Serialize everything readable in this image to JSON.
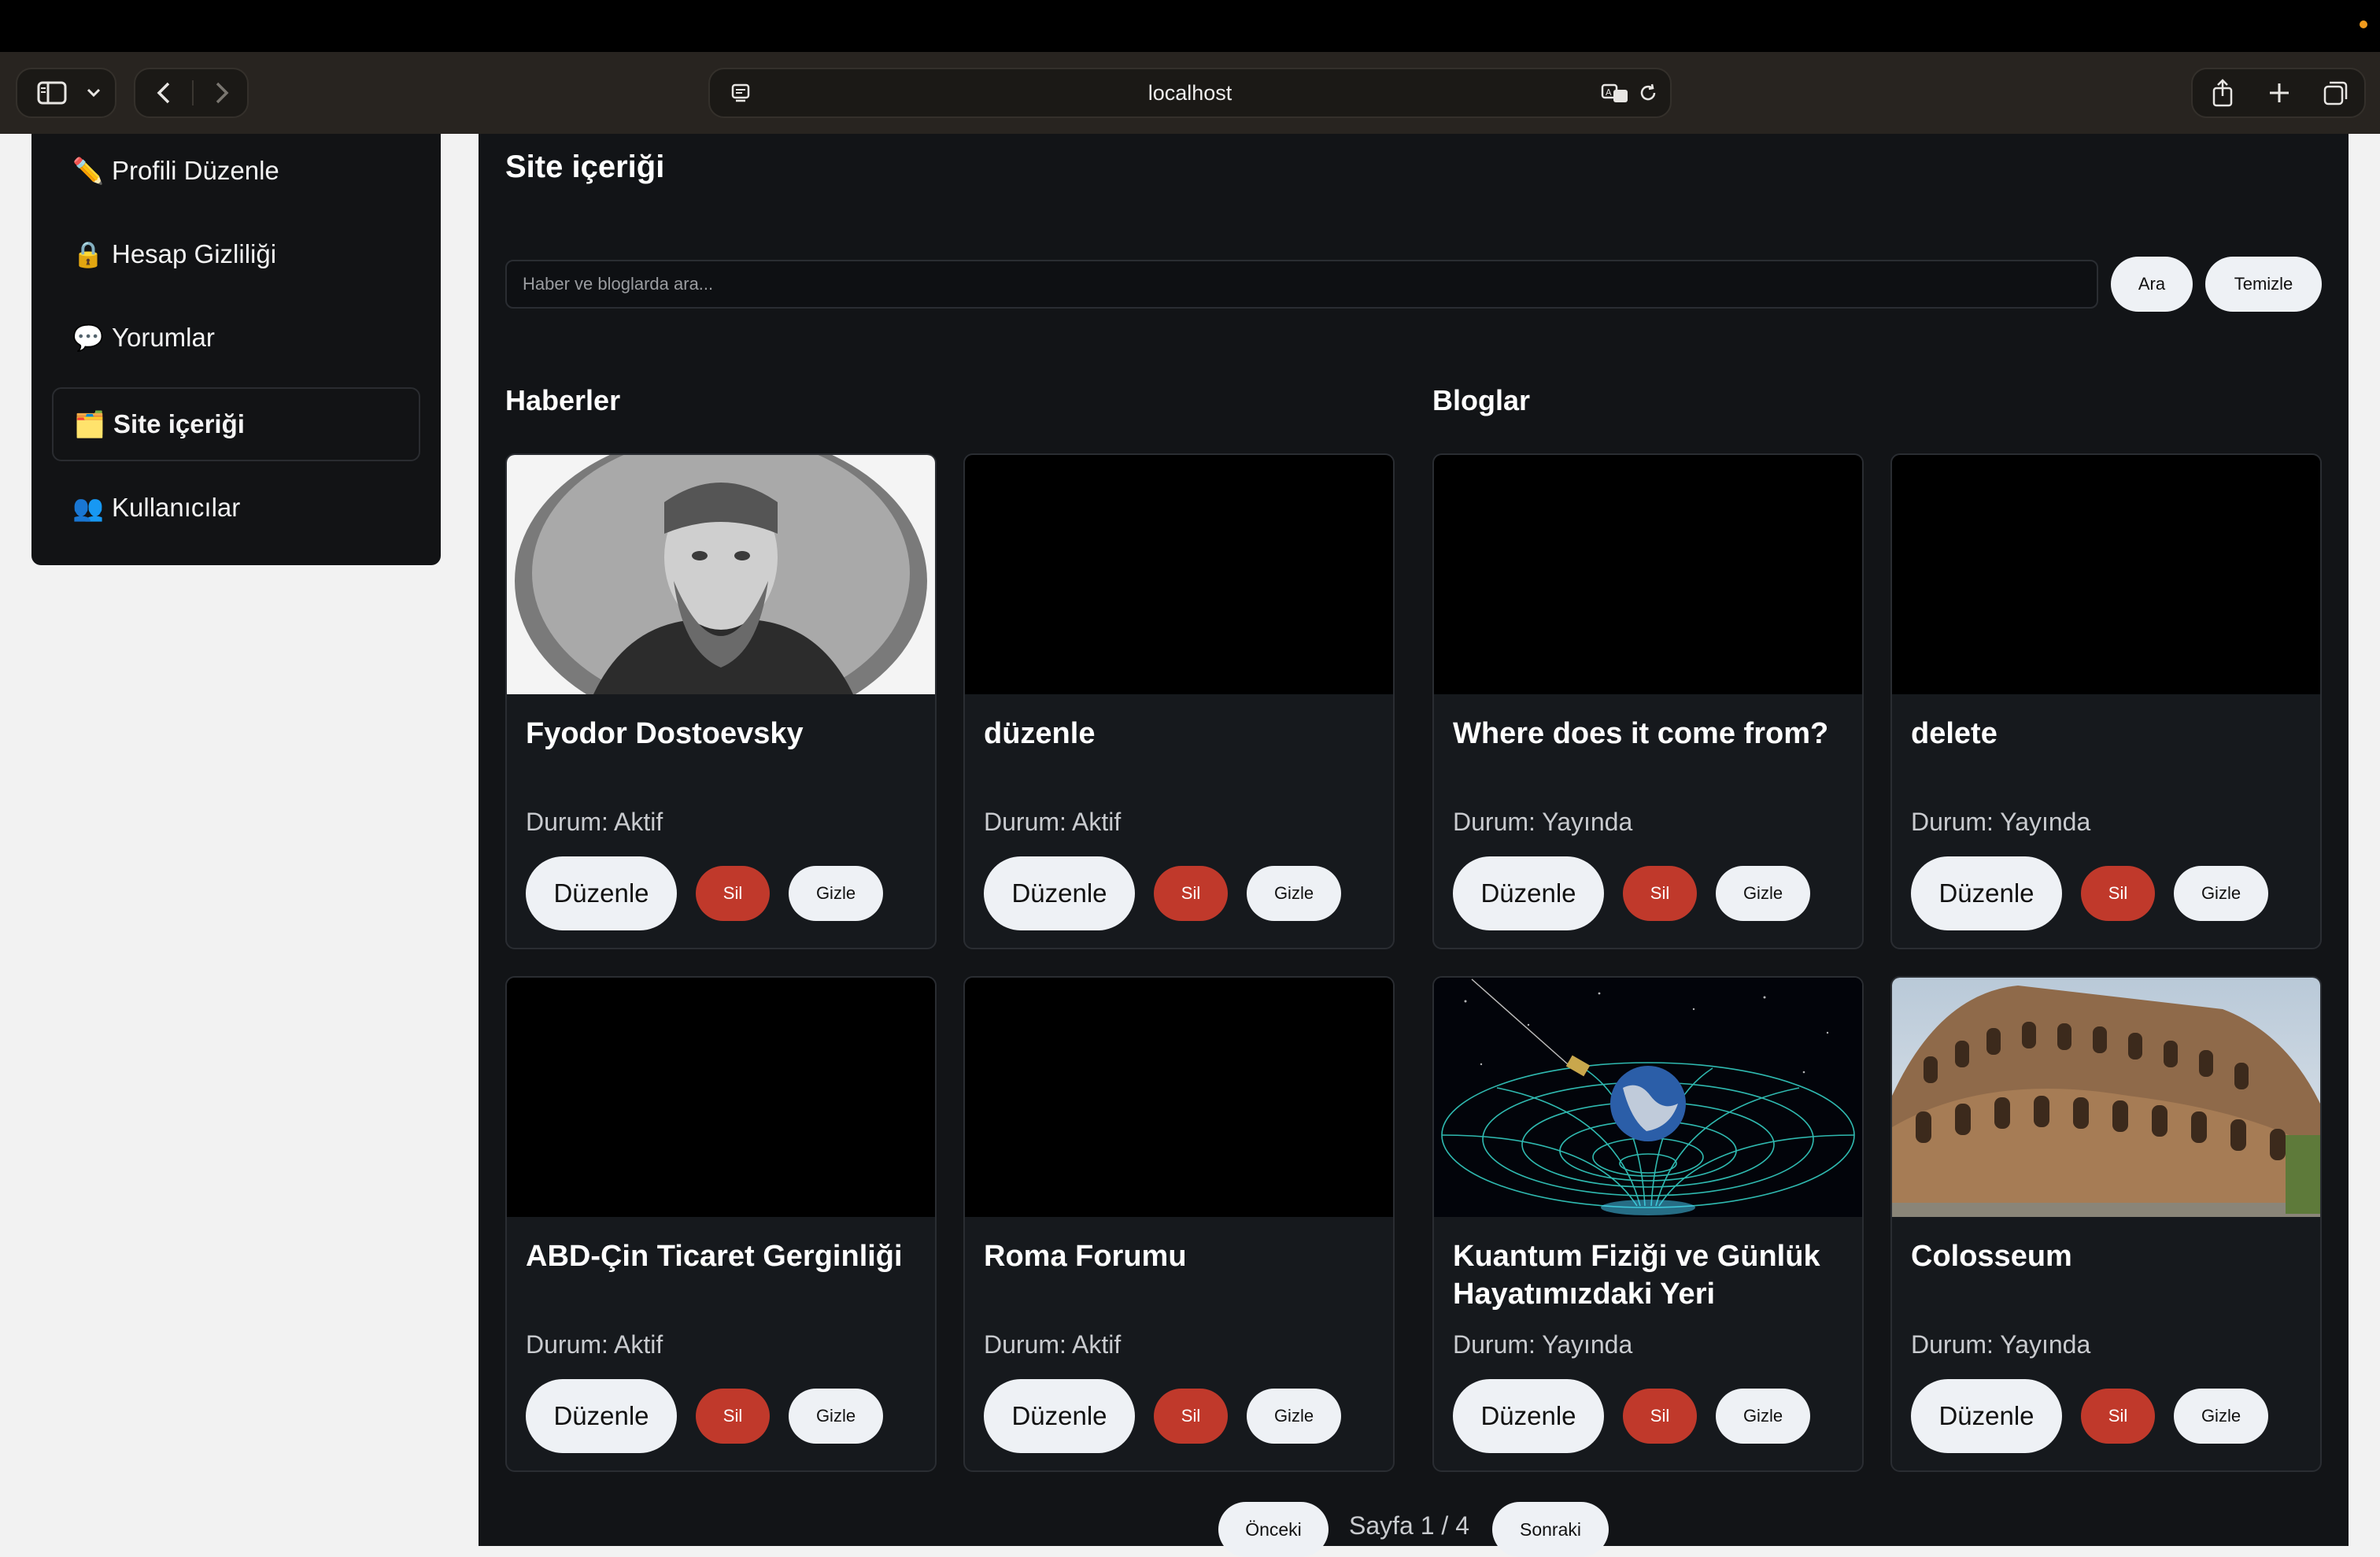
{
  "browser": {
    "url": "localhost"
  },
  "sidebar": {
    "items": [
      {
        "emoji": "✏️",
        "label": "Profili Düzenle",
        "active": false
      },
      {
        "emoji": "🔒",
        "label": "Hesap Gizliliği",
        "active": false
      },
      {
        "emoji": "💬",
        "label": "Yorumlar",
        "active": false
      },
      {
        "emoji": "🗂️",
        "label": "Site içeriği",
        "active": true
      },
      {
        "emoji": "👥",
        "label": "Kullanıcılar",
        "active": false
      }
    ]
  },
  "main": {
    "title": "Site içeriği",
    "search": {
      "placeholder": "Haber ve bloglarda ara...",
      "value": "",
      "search_label": "Ara",
      "clear_label": "Temizle"
    },
    "news_title": "Haberler",
    "blogs_title": "Bloglar",
    "card_actions": {
      "edit": "Düzenle",
      "delete": "Sil",
      "hide": "Gizle"
    },
    "news": [
      {
        "title": "Fyodor Dostoevsky",
        "status": "Durum: Aktif",
        "image": "portrait"
      },
      {
        "title": "düzenle",
        "status": "Durum: Aktif",
        "image": "none"
      },
      {
        "title": "ABD-Çin Ticaret Gerginliği",
        "status": "Durum: Aktif",
        "image": "none"
      },
      {
        "title": "Roma Forumu",
        "status": "Durum: Aktif",
        "image": "none"
      }
    ],
    "blogs": [
      {
        "title": "Where does it come from?",
        "status": "Durum: Yayında",
        "image": "none"
      },
      {
        "title": "delete",
        "status": "Durum: Yayında",
        "image": "none"
      },
      {
        "title": "Kuantum Fiziği ve Günlük Hayatımızdaki Yeri",
        "status": "Durum: Yayında",
        "image": "spacetime"
      },
      {
        "title": "Colosseum",
        "status": "Durum: Yayında",
        "image": "colosseum"
      }
    ],
    "pagination": {
      "prev_label": "Önceki",
      "page_text": "Sayfa 1 / 4",
      "next_label": "Sonraki"
    }
  },
  "colors": {
    "accent_delete": "#c0392b",
    "panel": "#121417",
    "toolbar": "#282420"
  }
}
